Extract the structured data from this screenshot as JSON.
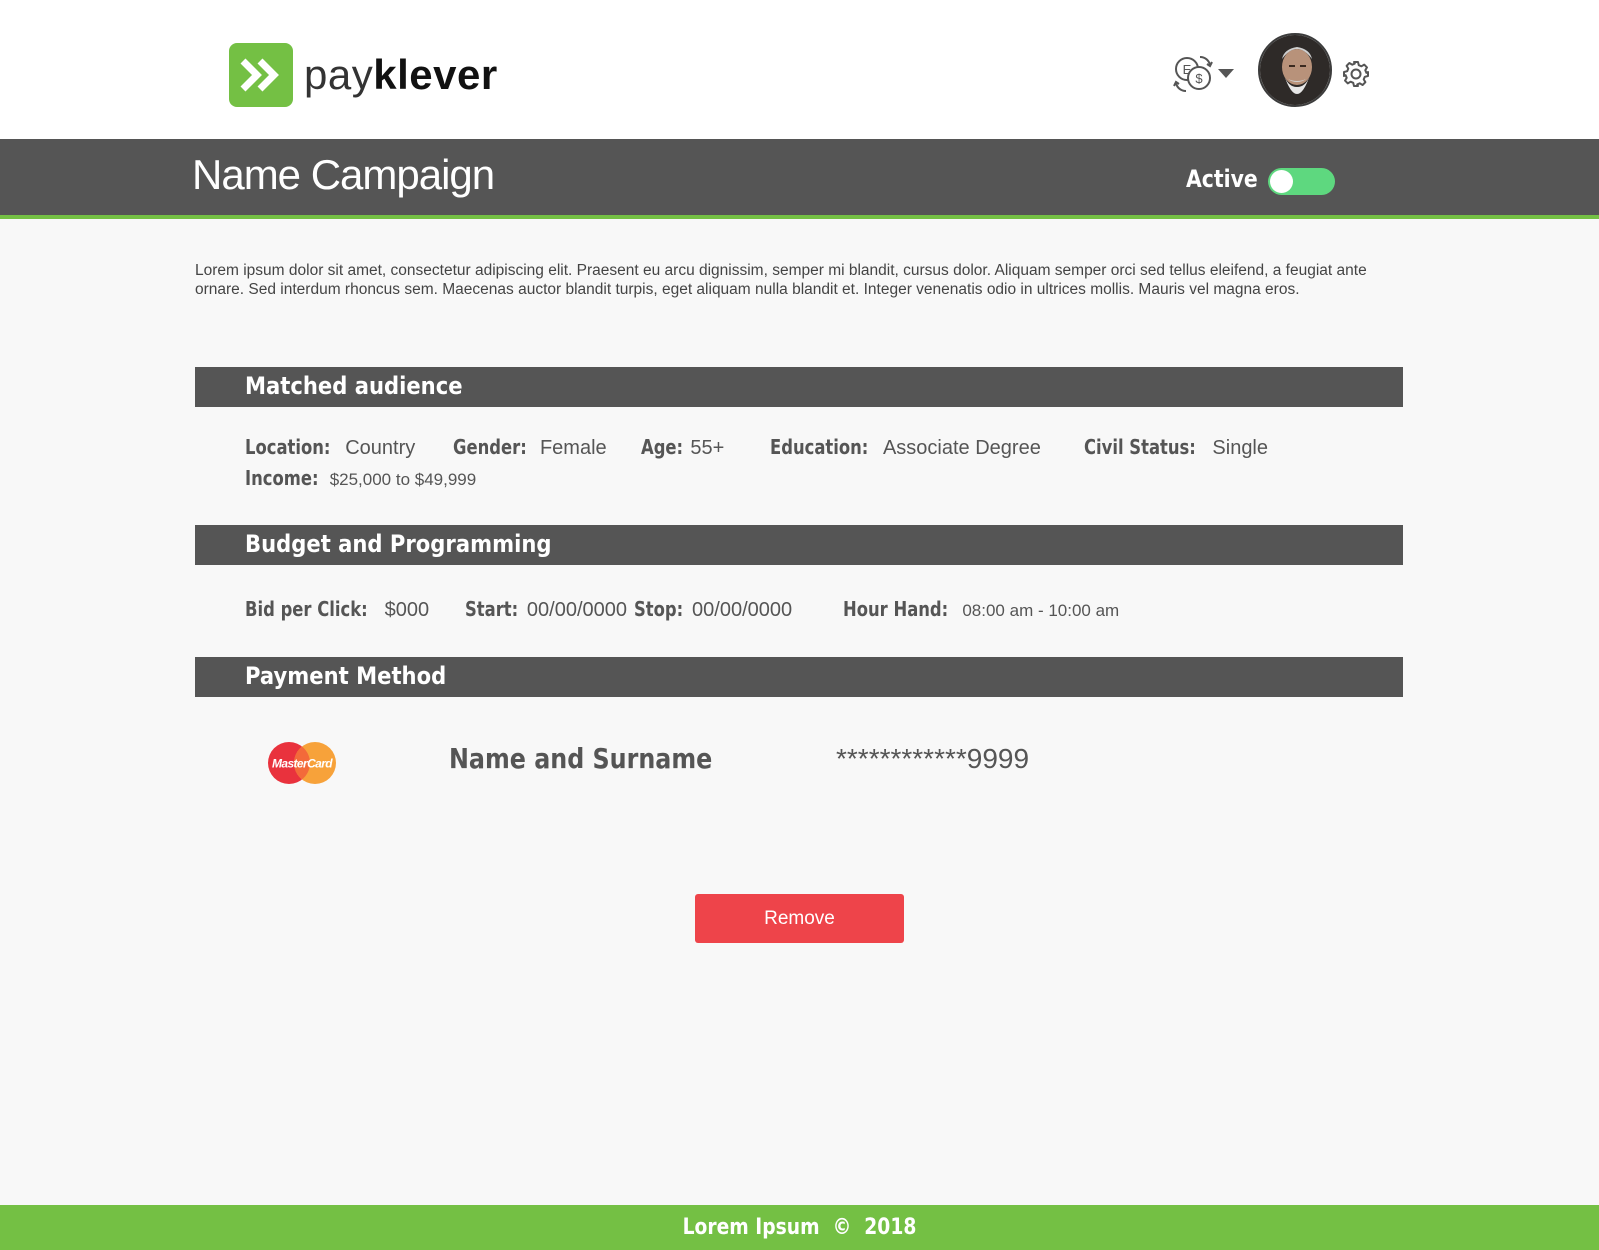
{
  "brand": {
    "name_light": "pay",
    "name_bold": "klever",
    "accent": "#74c044"
  },
  "header": {
    "language_icon": "currency-exchange-icon",
    "settings_icon": "gear-icon"
  },
  "campaign": {
    "title": "Name Campaign",
    "status_label": "Active",
    "status_on": true,
    "description": "Lorem ipsum dolor sit amet, consectetur adipiscing elit. Praesent eu arcu dignissim, semper mi blandit, cursus dolor. Aliquam semper orci sed tellus eleifend, a feugiat ante ornare. Sed interdum rhoncus sem. Maecenas auctor blandit turpis, eget aliquam nulla blandit et. Integer venenatis odio in ultrices mollis. Mauris vel magna eros."
  },
  "audience": {
    "title": "Matched audience",
    "location_label": "Location:",
    "location_value": "Country",
    "gender_label": "Gender:",
    "gender_value": "Female",
    "age_label": "Age:",
    "age_value": "55+",
    "education_label": "Education:",
    "education_value": "Associate Degree",
    "civil_label": "Civil Status:",
    "civil_value": "Single",
    "income_label": "Income:",
    "income_value": "$25,000 to $49,999"
  },
  "budget": {
    "title": "Budget and Programming",
    "bid_label": "Bid per Click:",
    "bid_value": "$000",
    "start_label": "Start:",
    "start_value": "00/00/0000",
    "stop_label": "Stop:",
    "stop_value": "00/00/0000",
    "hour_label": "Hour Hand:",
    "hour_value": "08:00 am - 10:00 am"
  },
  "payment": {
    "title": "Payment Method",
    "card_brand": "MasterCard",
    "card_holder": "Name and Surname",
    "card_number": "************9999"
  },
  "actions": {
    "remove_label": "Remove",
    "remove_color": "#ee444a"
  },
  "footer": {
    "text": "Lorem Ipsum  ©  2018"
  }
}
